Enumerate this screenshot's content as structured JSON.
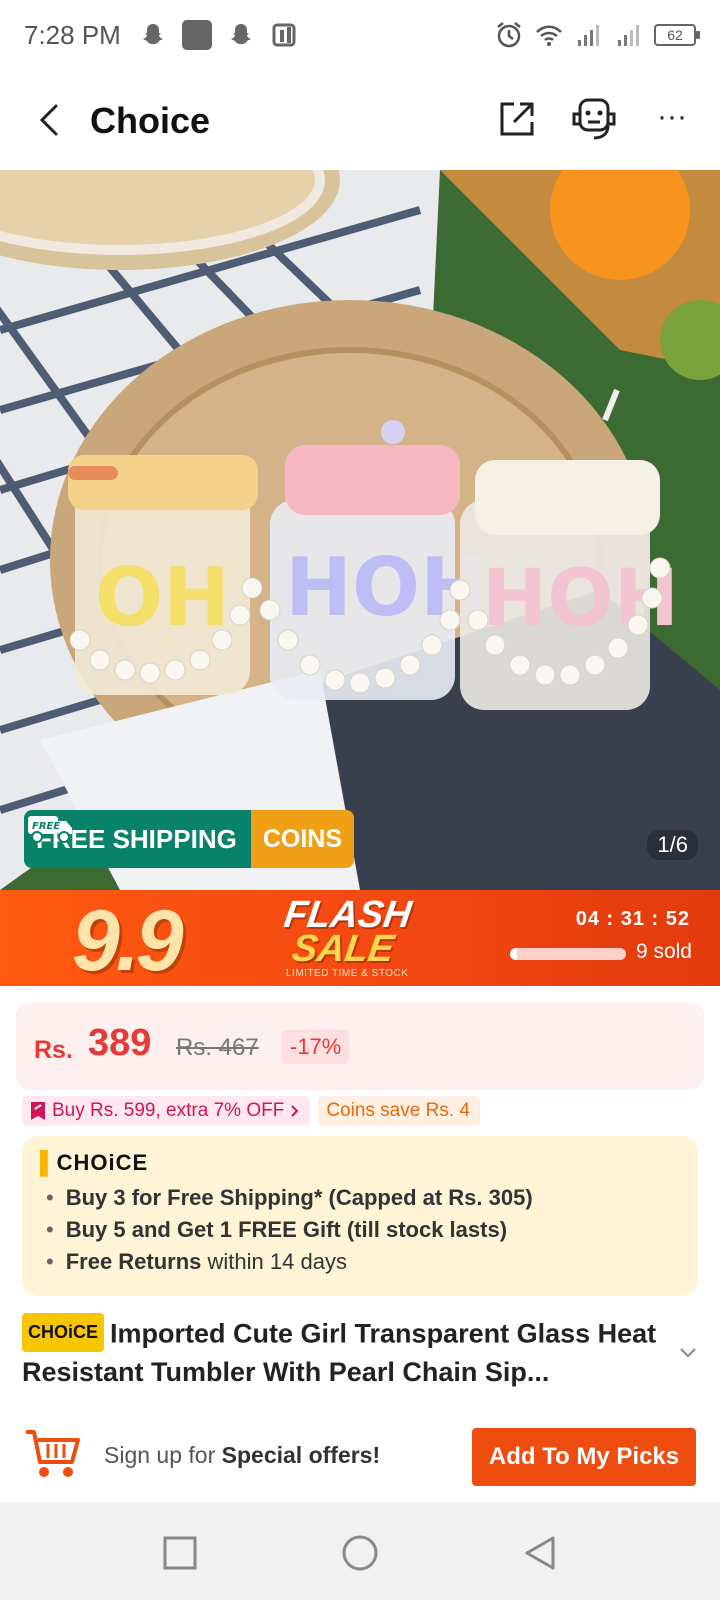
{
  "status": {
    "time": "7:28 PM",
    "battery": "62"
  },
  "header": {
    "title": "Choice"
  },
  "hero": {
    "free_shipping_label": "FREE SHIPPING",
    "free_tag": "FREE",
    "coins_label": "COINS",
    "image_counter": "1/6"
  },
  "flash_sale": {
    "event_number": "9.9",
    "title_line1": "FLASH",
    "title_line2": "SALE",
    "subtitle": "LIMITED TIME & STOCK",
    "timer": "04 : 31 : 52",
    "sold": "9 sold",
    "sold_progress": 0.06
  },
  "price": {
    "currency": "Rs.",
    "value": "389",
    "original": "Rs. 467",
    "discount": "-17%"
  },
  "promos": {
    "bundle": "Buy Rs. 599, extra 7% OFF",
    "coins": "Coins save Rs. 4"
  },
  "choice": {
    "logo": "CHOiCE",
    "items": [
      {
        "bold": "Buy 3 for  Free Shipping* (Capped at Rs. 305)",
        "rest": ""
      },
      {
        "bold": "Buy 5 and Get 1 FREE Gift (till stock lasts)",
        "rest": ""
      },
      {
        "bold": "Free Returns",
        "rest": " within 14 days"
      }
    ]
  },
  "product": {
    "badge": "CHOiCE",
    "title": "Imported Cute Girl Transparent Glass Heat Resistant Tumbler With Pearl Chain Sip..."
  },
  "actions": {
    "signup_prefix": "Sign up for ",
    "signup_bold": "Special offers!",
    "add_picks": "Add To My Picks"
  },
  "colors": {
    "accent": "#ee4d0f",
    "price": "#e63a3a",
    "shipping": "#08836a",
    "coins": "#f0a016",
    "choice_bg": "#fff5d6"
  }
}
